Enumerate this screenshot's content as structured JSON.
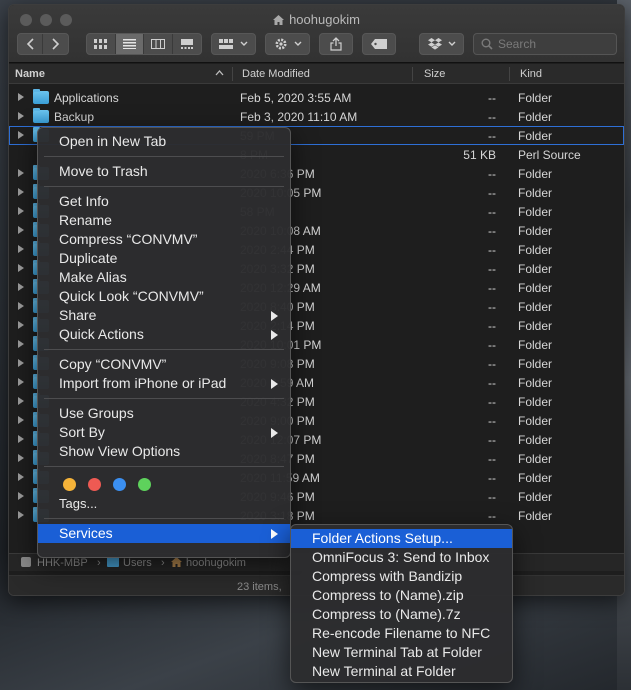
{
  "window": {
    "title": "hoohugokim"
  },
  "toolbar": {
    "search_placeholder": "Search"
  },
  "columns": {
    "name": "Name",
    "date": "Date Modified",
    "size": "Size",
    "kind": "Kind"
  },
  "rows": [
    {
      "name": "Applications",
      "date": "Feb 5, 2020 3:55 AM",
      "size": "--",
      "kind": "Folder",
      "folder": true
    },
    {
      "name": "Backup",
      "date": "Feb 3, 2020 11:10 AM",
      "size": "--",
      "kind": "Folder",
      "folder": true
    },
    {
      "name": "",
      "date": "59 PM",
      "size": "--",
      "kind": "Folder",
      "folder": true
    },
    {
      "name": "",
      "date": "8 PM",
      "size": "51 KB",
      "kind": "Perl Source",
      "folder": false
    },
    {
      "name": "",
      "date": "2020 6:36 PM",
      "size": "--",
      "kind": "Folder",
      "folder": true
    },
    {
      "name": "",
      "date": "2020 10:05 PM",
      "size": "--",
      "kind": "Folder",
      "folder": true
    },
    {
      "name": "",
      "date": "58 PM",
      "size": "--",
      "kind": "Folder",
      "folder": true
    },
    {
      "name": "",
      "date": "2020 10:08 AM",
      "size": "--",
      "kind": "Folder",
      "folder": true
    },
    {
      "name": "",
      "date": "2020 2:44 PM",
      "size": "--",
      "kind": "Folder",
      "folder": true
    },
    {
      "name": "",
      "date": "2020 3:32 PM",
      "size": "--",
      "kind": "Folder",
      "folder": true
    },
    {
      "name": "",
      "date": "2020 12:29 AM",
      "size": "--",
      "kind": "Folder",
      "folder": true
    },
    {
      "name": "",
      "date": "2020 8:40 PM",
      "size": "--",
      "kind": "Folder",
      "folder": true
    },
    {
      "name": "",
      "date": "2020 2:14 PM",
      "size": "--",
      "kind": "Folder",
      "folder": true
    },
    {
      "name": "",
      "date": "2020 10:01 PM",
      "size": "--",
      "kind": "Folder",
      "folder": true
    },
    {
      "name": "",
      "date": "2020 9:08 PM",
      "size": "--",
      "kind": "Folder",
      "folder": true
    },
    {
      "name": "",
      "date": "2020 3:59 AM",
      "size": "--",
      "kind": "Folder",
      "folder": true
    },
    {
      "name": "",
      "date": "2020 4:32 PM",
      "size": "--",
      "kind": "Folder",
      "folder": true
    },
    {
      "name": "",
      "date": "2020 9:00 PM",
      "size": "--",
      "kind": "Folder",
      "folder": true
    },
    {
      "name": "",
      "date": "2020 12:07 PM",
      "size": "--",
      "kind": "Folder",
      "folder": true
    },
    {
      "name": "",
      "date": "2020 8:47 PM",
      "size": "--",
      "kind": "Folder",
      "folder": true
    },
    {
      "name": "",
      "date": "2020 11:59 AM",
      "size": "--",
      "kind": "Folder",
      "folder": true
    },
    {
      "name": "",
      "date": "2020 9:46 PM",
      "size": "--",
      "kind": "Folder",
      "folder": true
    },
    {
      "name": "",
      "date": "2020 3:18 PM",
      "size": "--",
      "kind": "Folder",
      "folder": true
    }
  ],
  "pathbar": {
    "drive": "HHK-MBP",
    "users": "Users",
    "home": "hoohugokim"
  },
  "status": {
    "text": "23 items,"
  },
  "context_menu": {
    "open_new_tab": "Open in New Tab",
    "move_to_trash": "Move to Trash",
    "get_info": "Get Info",
    "rename": "Rename",
    "compress": "Compress “CONVMV”",
    "duplicate": "Duplicate",
    "make_alias": "Make Alias",
    "quick_look": "Quick Look “CONVMV”",
    "share": "Share",
    "quick_actions": "Quick Actions",
    "copy": "Copy “CONVMV”",
    "import_iphone": "Import from iPhone or iPad",
    "use_groups": "Use Groups",
    "sort_by": "Sort By",
    "show_view_options": "Show View Options",
    "tags": "Tags...",
    "services": "Services",
    "tag_colors": [
      "#f5b339",
      "#ee5a53",
      "#3b8ff0",
      "#5ed25c"
    ]
  },
  "services_menu": {
    "items": [
      "Folder Actions Setup...",
      "OmniFocus 3: Send to Inbox",
      "Compress with Bandizip",
      "Compress to (Name).zip",
      "Compress to (Name).7z",
      "Re-encode Filename to NFC",
      "New Terminal Tab at Folder",
      "New Terminal at Folder"
    ]
  }
}
